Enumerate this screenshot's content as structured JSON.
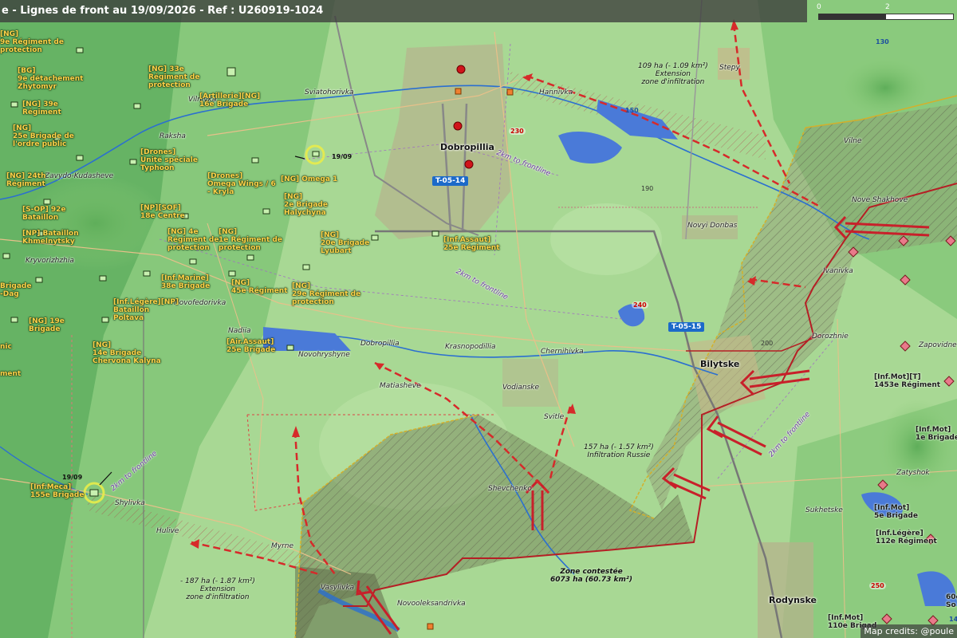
{
  "title": "e - Lignes de front au 19/09/2026 - Ref : U260919-1024",
  "scale": {
    "start": "0",
    "mid": "2"
  },
  "roads": [
    "T-05-14",
    "T-05-15"
  ],
  "towns": [
    "Dobropillia",
    "Bilytske",
    "Rodynske"
  ],
  "places": [
    "Vilnivka",
    "Sviatohorivka",
    "Hannivka",
    "Stepy",
    "Raksha",
    "Zavydo-Kudasheve",
    "Kryvorizhzhia",
    "Novofedorivka",
    "Nadiia",
    "Novohryshyne",
    "Dobropillia",
    "Krasnopodillia",
    "Chernihivka",
    "Matiasheve",
    "Vodianske",
    "Svitle",
    "Shevchenko",
    "Shylivka",
    "Hulive",
    "Myrne",
    "Vasylivka",
    "Novooleksandrivka",
    "Novyi Donbas",
    "Vilne",
    "Nove Shakhove",
    "Ivanivka",
    "Dorozhnie",
    "Zapovidne",
    "Zatyshok",
    "Sukhetske"
  ],
  "units_left": [
    "[NG]\n9e Régiment de\nprotection",
    "[BG]\n9e détachement\nZhytomyr",
    "[NG] 39e\nRégiment",
    "[NG]\n25e Brigade de\nl'ordre public",
    "[NG] 24th\nRégiment",
    "[S-OP] 92e\nBataillon",
    "[NP] Bataillon\nKhmelnytsky",
    "Brigade\n-Dag",
    "[NG] 19e\nBrigade",
    "nic",
    "ment",
    "[NG] 33e\nRégiment de\nprotection",
    "[Artillerie][NG]\n16e Brigade",
    "[Drones]\nUnité spéciale\nTyphoon",
    "[Drones]\nOmega Wings / 6\n- Kryla",
    "[NG] Omega 1",
    "[NP][SOF]\n18e Centre",
    "[NG]\n2e Brigade\nHalychyna",
    "[NG] 4e\nRégiment de\nprotection",
    "[NG]\n1e Régiment de\nprotection",
    "[NG]\n20e Brigade\nLyubart",
    "[Inf.Assaut]\n25e Régiment",
    "[Inf.Marine]\n38e Brigade",
    "[NG]\n45e Régiment",
    "[NG]\n29e Régiment de\nprotection",
    "[Inf.Légère][NP]\nBataillon\nPoltava",
    "[NG]\n14e Brigade\nChervona Kalyna",
    "[Air.Assaut]\n25e Brigade",
    "[Inf.Meca]\n155e Brigade"
  ],
  "units_right": [
    "[Inf.Mot][T]\n1453e Régiment",
    "[Inf.Mot]\n1e Brigade",
    "[Inf.Mot]\n5e Brigade",
    "[Inf.Légère]\n112e Régiment",
    "[Inf.Mot]\n110e Brigad",
    "60e\nSo"
  ],
  "dates": [
    "19/09",
    "19/09"
  ],
  "frontline_labels": [
    "2km to frontline",
    "2km to frontline",
    "2km to frontline",
    "2km to frontline"
  ],
  "annotations": [
    "109 ha (- 1.09 km²)\nExtension\nzone d'infiltration",
    "157 ha (- 1.57 km²)\nInfiltration Russie",
    "- 187 ha (- 1.87 km²)\nExtension\nzone d'infiltration",
    "Zone contestée\n6073 ha (60.73 km²)"
  ],
  "hills": [
    "130",
    "150",
    "230",
    "190",
    "240",
    "200",
    "250",
    "14"
  ],
  "credits": "Map credits: @poule",
  "colors": {
    "friendly_unit": "#ffd24a",
    "russian_unit": "#e87a8a",
    "front": "#c8202a",
    "contested": "#6e7a52",
    "water": "#4a90d6"
  }
}
